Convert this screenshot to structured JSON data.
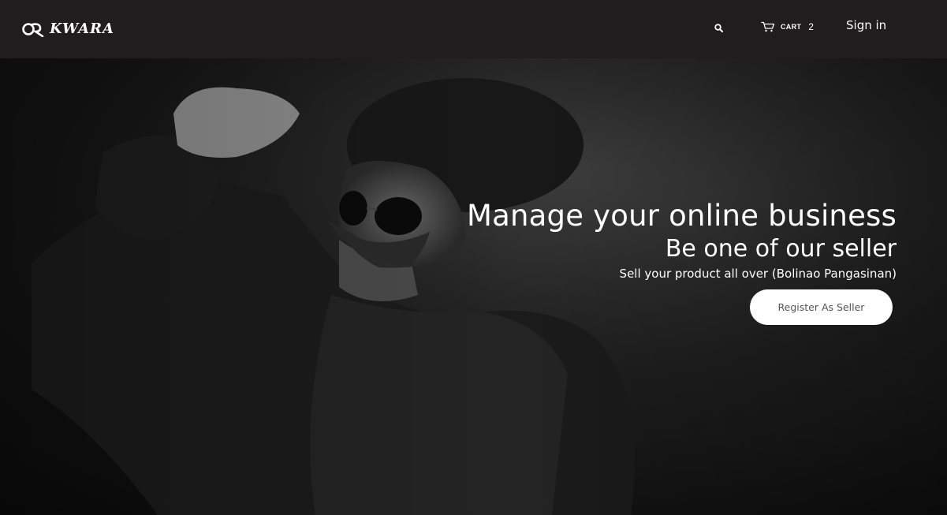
{
  "header": {
    "brand_name": "KWARA",
    "search_icon": "search-icon",
    "cart": {
      "icon": "cart-icon",
      "label": "CART",
      "count": "2"
    },
    "signin_label": "Sign in"
  },
  "hero": {
    "title": "Manage your online business",
    "subtitle": "Be one of our seller",
    "tagline": "Sell your product all over (Bolinao Pangasinan)",
    "register_button_label": "Register As Seller"
  },
  "colors": {
    "navbar_bg": "#1f1d1e",
    "hero_text": "#ffffff",
    "button_bg": "#ffffff",
    "button_text": "#555555"
  }
}
